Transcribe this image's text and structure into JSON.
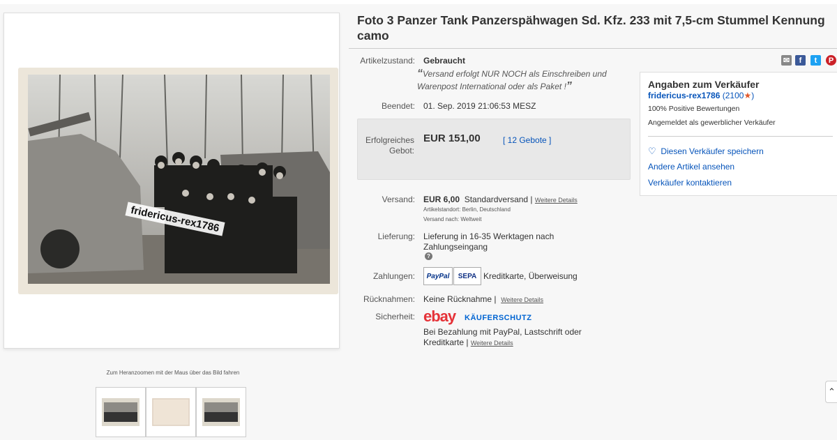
{
  "listing": {
    "title": "Foto 3 Panzer Tank Panzerspähwagen Sd. Kfz. 233 mit 7,5-cm Stummel Kennung camo",
    "watermark": "fridericus-rex1786",
    "zoom_hint": "Zum Heranzoomen mit der Maus über das Bild fahren"
  },
  "details": {
    "condition_label": "Artikelzustand:",
    "condition_value": "Gebraucht",
    "quote_open": "“",
    "condition_note": "Versand erfolgt NUR NOCH als Einschreiben und Warenpost International oder als Paket !",
    "quote_close": "”",
    "ended_label": "Beendet:",
    "ended_value": "01. Sep. 2019  21:06:53 MESZ",
    "bid_label": "Erfolgreiches Gebot:",
    "bid_price": "EUR 151,00",
    "bid_count": "[ 12 Gebote ]",
    "shipping_label": "Versand:",
    "shipping_price": "EUR 6,00",
    "shipping_method": "Standardversand |",
    "shipping_more": "Weitere Details",
    "item_location": "Artikelstandort:  Berlin, Deutschland",
    "ships_to": "Versand nach:  Weltweit",
    "delivery_label": "Lieferung:",
    "delivery_value": "Lieferung in 16-35 Werktagen nach Zahlungseingang",
    "payment_label": "Zahlungen:",
    "payment_paypal": "PayPal",
    "payment_sepa": "SEPA",
    "payment_other": "Kreditkarte, Überweisung",
    "returns_label": "Rücknahmen:",
    "returns_value": "Keine Rücknahme |",
    "returns_more": "Weitere Details",
    "security_label": "Sicherheit:",
    "ebay_logo": "ebay",
    "buyer_protection": "KÄUFERSCHUTZ",
    "security_text_1": "Bei Bezahlung mit PayPal, Lastschrift oder",
    "security_text_2": "Kreditkarte |",
    "security_more": "Weitere Details"
  },
  "seller": {
    "heading": "Angaben zum Verkäufer",
    "name": "fridericus-rex1786",
    "score": "(2100",
    "score_close": ")",
    "positive": "100% Positive Bewertungen",
    "registered": "Angemeldet als gewerblicher Verkäufer",
    "save_seller": "Diesen Verkäufer speichern",
    "other_items": "Andere Artikel ansehen",
    "contact": "Verkäufer kontaktieren"
  },
  "share_icons": [
    "email-icon",
    "facebook-icon",
    "twitter-icon",
    "pinterest-icon"
  ],
  "colors": {
    "link": "#0654ba",
    "price": "#333333",
    "ebay_red": "#e53238",
    "ebay_blue": "#0064d2",
    "ebay_yellow": "#f5af02",
    "ebay_green": "#86b817"
  }
}
